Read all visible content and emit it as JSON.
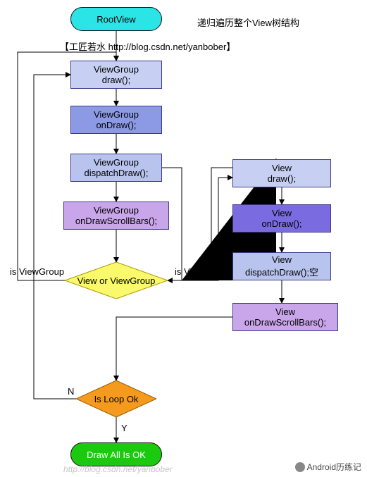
{
  "nodes": {
    "root": "RootView",
    "caption_right": "递归遍历整个View树结构",
    "credit": "【工匠若水 http://blog.csdn.net/yanbober】",
    "vg_draw_l1": "ViewGroup",
    "vg_draw_l2": "draw();",
    "vg_ondraw_l1": "ViewGroup",
    "vg_ondraw_l2": "onDraw();",
    "vg_dispatch_l1": "ViewGroup",
    "vg_dispatch_l2": "dispatchDraw();",
    "vg_scroll_l1": "ViewGroup",
    "vg_scroll_l2": "onDrawScrollBars();",
    "v_draw_l1": "View",
    "v_draw_l2": "draw();",
    "v_ondraw_l1": "View",
    "v_ondraw_l2": "onDraw();",
    "v_dispatch_l1": "View",
    "v_dispatch_l2": "dispatchDraw();空",
    "v_scroll_l1": "View",
    "v_scroll_l2": "onDrawScrollBars();",
    "decision_view": "View or ViewGroup",
    "decision_loop": "Is Loop Ok",
    "end": "Draw All Is OK"
  },
  "edge_labels": {
    "is_viewgroup": "is ViewGroup",
    "is_view": "is View",
    "loop_n": "N",
    "loop_y": "Y"
  },
  "colors": {
    "root": "#2be4e6",
    "vg_draw": "#c7d0f2",
    "vg_ondraw": "#8c9ae5",
    "vg_dispatch": "#b8c4ee",
    "vg_scroll": "#c9a6e9",
    "v_draw": "#c7d0f2",
    "v_ondraw": "#7a6ce0",
    "v_dispatch": "#b8c4ee",
    "v_scroll": "#c9a6e9",
    "diamond_view": "#f9f96b",
    "diamond_loop": "#f59a1d",
    "end": "#1bc90f"
  },
  "footer": {
    "watermark": "http://blog.csdn.net/yanbober",
    "signature": "Android历练记"
  },
  "chart_data": {
    "type": "flowchart",
    "title": "递归遍历整个View树结构",
    "nodes": [
      {
        "id": "root",
        "type": "terminal",
        "label": "RootView"
      },
      {
        "id": "vg_draw",
        "type": "process",
        "label": "ViewGroup draw();"
      },
      {
        "id": "vg_ondraw",
        "type": "process",
        "label": "ViewGroup onDraw();"
      },
      {
        "id": "vg_dispatch",
        "type": "process",
        "label": "ViewGroup dispatchDraw();"
      },
      {
        "id": "vg_scroll",
        "type": "process",
        "label": "ViewGroup onDrawScrollBars();"
      },
      {
        "id": "decision_view",
        "type": "decision",
        "label": "View or ViewGroup"
      },
      {
        "id": "v_draw",
        "type": "process",
        "label": "View draw();"
      },
      {
        "id": "v_ondraw",
        "type": "process",
        "label": "View onDraw();"
      },
      {
        "id": "v_dispatch",
        "type": "process",
        "label": "View dispatchDraw();空"
      },
      {
        "id": "v_scroll",
        "type": "process",
        "label": "View onDrawScrollBars();"
      },
      {
        "id": "decision_loop",
        "type": "decision",
        "label": "Is Loop Ok"
      },
      {
        "id": "end",
        "type": "terminal",
        "label": "Draw All Is OK"
      }
    ],
    "edges": [
      {
        "from": "root",
        "to": "vg_draw"
      },
      {
        "from": "vg_draw",
        "to": "vg_ondraw"
      },
      {
        "from": "vg_ondraw",
        "to": "vg_dispatch"
      },
      {
        "from": "vg_dispatch",
        "to": "vg_scroll"
      },
      {
        "from": "vg_dispatch",
        "to": "decision_view"
      },
      {
        "from": "vg_scroll",
        "to": "decision_view"
      },
      {
        "from": "decision_view",
        "to": "vg_draw",
        "label": "is ViewGroup"
      },
      {
        "from": "decision_view",
        "to": "v_draw",
        "label": "is View"
      },
      {
        "from": "v_draw",
        "to": "v_ondraw"
      },
      {
        "from": "v_ondraw",
        "to": "v_dispatch"
      },
      {
        "from": "v_dispatch",
        "to": "v_scroll"
      },
      {
        "from": "v_scroll",
        "to": "decision_loop"
      },
      {
        "from": "decision_loop",
        "to": "vg_draw",
        "label": "N"
      },
      {
        "from": "decision_loop",
        "to": "end",
        "label": "Y"
      }
    ]
  }
}
